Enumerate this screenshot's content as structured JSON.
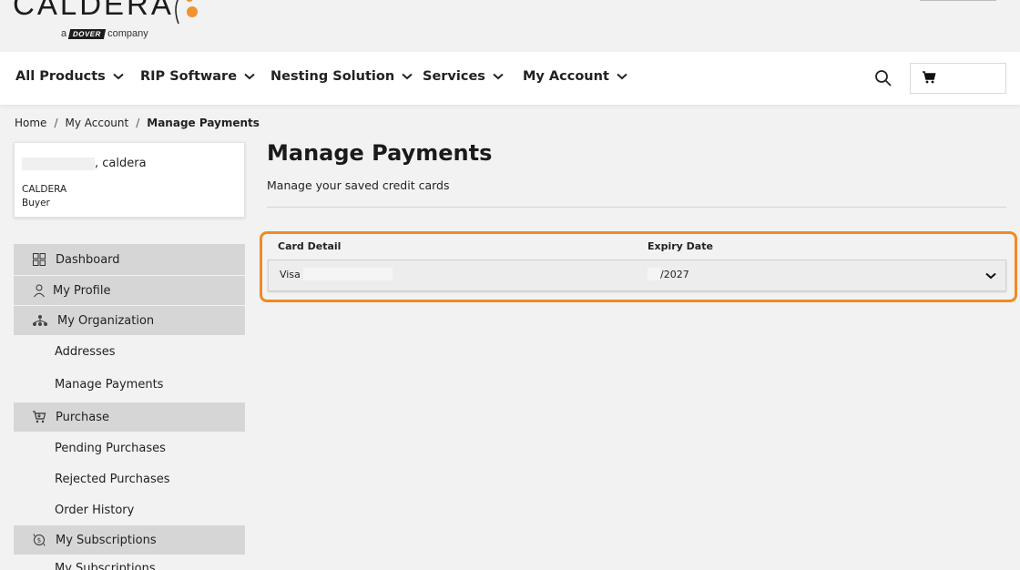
{
  "header": {
    "logo_text": "CALDERA",
    "logo_sub_prefix": "a",
    "logo_sub_brand": "DOVER",
    "logo_sub_suffix": "company"
  },
  "nav": {
    "items": [
      {
        "label": "All Products"
      },
      {
        "label": "RIP Software"
      },
      {
        "label": "Nesting Solution"
      },
      {
        "label": "Services"
      },
      {
        "label": "My Account"
      }
    ]
  },
  "breadcrumb": {
    "home": "Home",
    "parent": "My Account",
    "current": "Manage Payments"
  },
  "user_card": {
    "name_suffix": ", caldera",
    "org": "CALDERA",
    "role": "Buyer"
  },
  "sidebar": {
    "dashboard": "Dashboard",
    "my_profile": "My Profile",
    "my_organization": "My Organization",
    "addresses": "Addresses",
    "manage_payments": "Manage Payments",
    "purchase": "Purchase",
    "pending_purchases": "Pending Purchases",
    "rejected_purchases": "Rejected Purchases",
    "order_history": "Order History",
    "my_subscriptions_section": "My Subscriptions",
    "my_subscriptions_item": "My Subscriptions"
  },
  "main": {
    "title": "Manage Payments",
    "subtitle": "Manage your saved credit cards",
    "col_card_detail": "Card Detail",
    "col_expiry": "Expiry Date",
    "card": {
      "type": "Visa",
      "expiry": "/2027"
    }
  },
  "colors": {
    "accent_orange": "#f08a24",
    "sidebar_section": "#d6d6d6",
    "page_background": "#f2f2f2"
  },
  "icons": [
    "search-icon",
    "cart-icon",
    "chevron-down-icon",
    "dashboard-icon",
    "person-icon",
    "org-chart-icon",
    "cart-purchase-icon",
    "subscription-icon"
  ]
}
